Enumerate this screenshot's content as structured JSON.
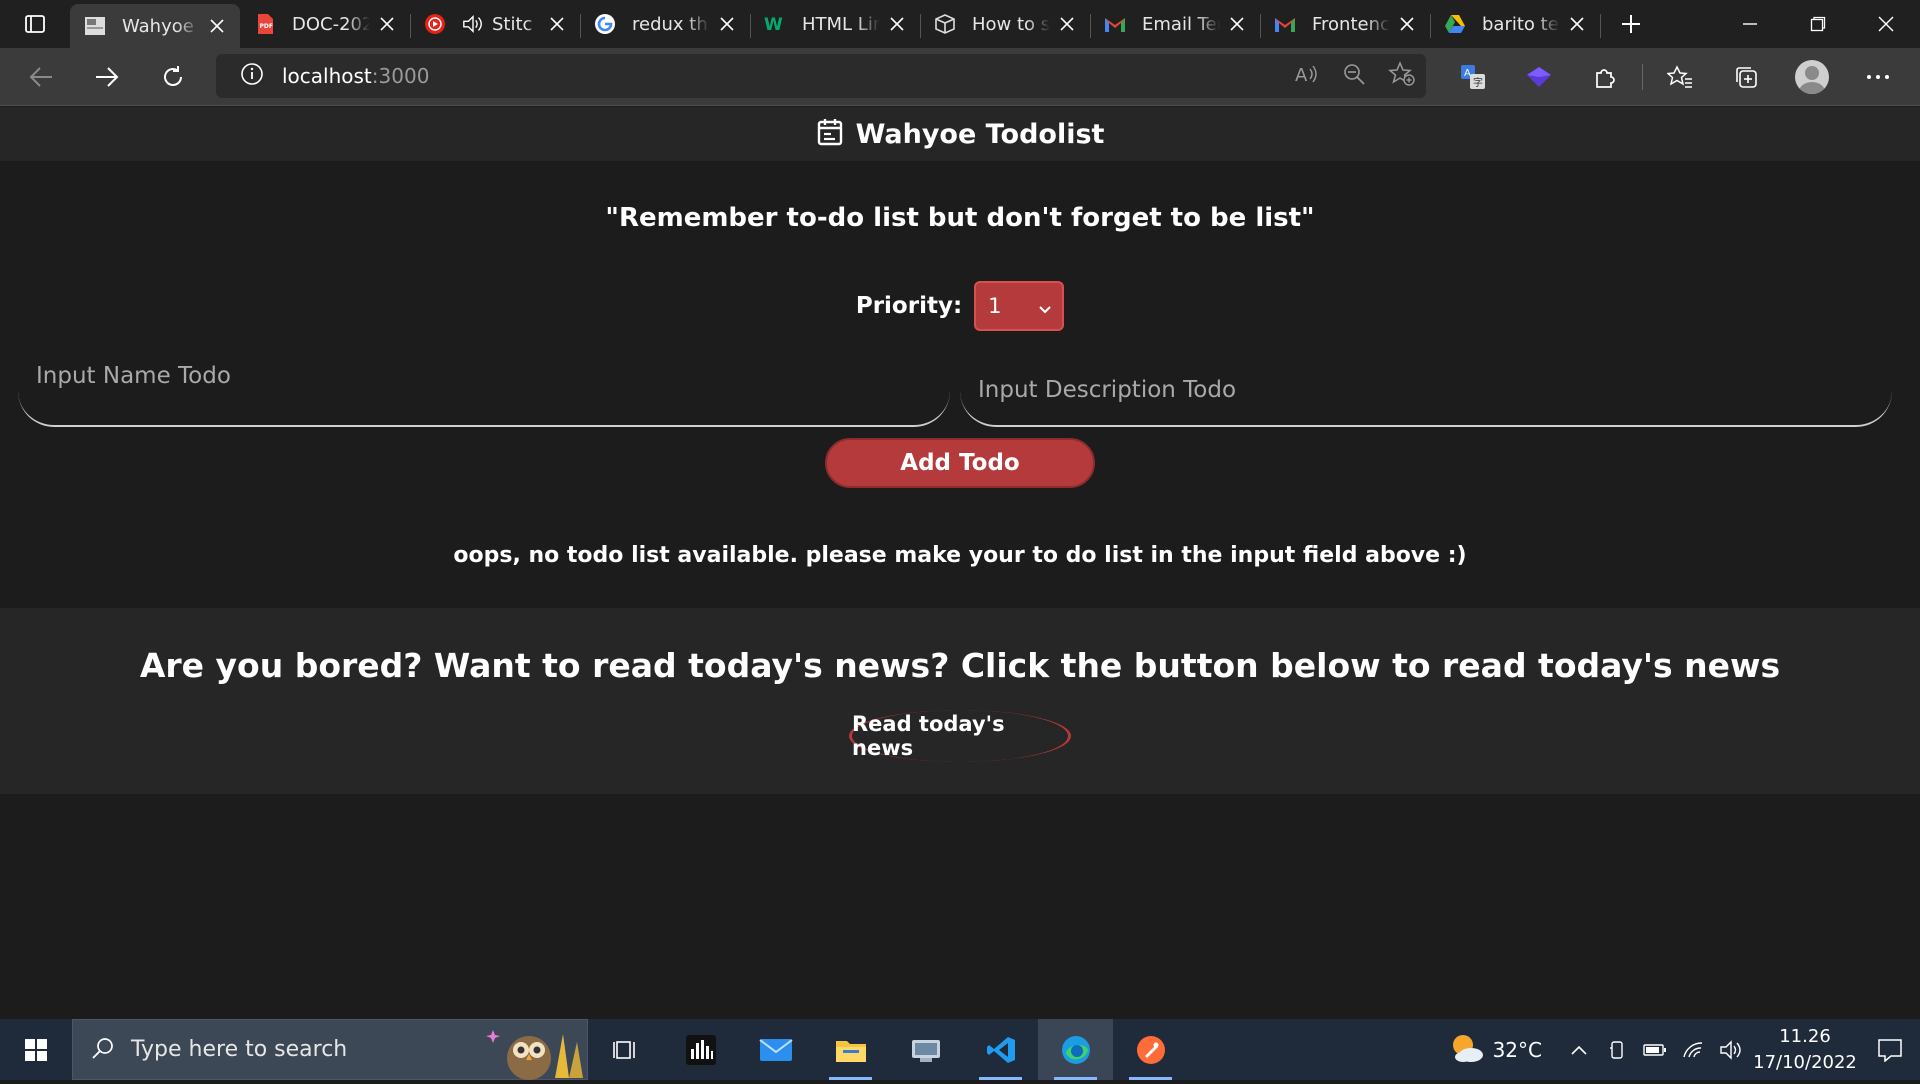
{
  "browser": {
    "tabs": [
      {
        "title": "Wahyoe",
        "icon": "page-favicon",
        "active": true
      },
      {
        "title": "DOC-202",
        "icon": "pdf-icon"
      },
      {
        "title": "Stitc",
        "icon": "youtube-icon",
        "audio": true
      },
      {
        "title": "redux th",
        "icon": "google-icon"
      },
      {
        "title": "HTML Lir",
        "icon": "w3schools-icon"
      },
      {
        "title": "How to s",
        "icon": "box-icon"
      },
      {
        "title": "Email Ter",
        "icon": "gmail-icon"
      },
      {
        "title": "Frontenc",
        "icon": "gmail-icon"
      },
      {
        "title": "barito te",
        "icon": "google-drive-icon"
      }
    ],
    "address": {
      "host": "localhost",
      "port": ":3000"
    }
  },
  "app": {
    "title": "Wahyoe Todolist",
    "quote": "\"Remember to-do list but don't forget to be list\"",
    "priority_label": "Priority:",
    "priority_value": "1",
    "name_placeholder": "Input Name Todo",
    "desc_placeholder": "Input Description Todo",
    "add_button": "Add Todo",
    "empty_message": "oops, no todo list available. please make your to do list in the input field above :)",
    "news_headline": "Are you bored? Want to read today's news? Click the button below to read today's news",
    "news_button": "Read today's news"
  },
  "taskbar": {
    "search_placeholder": "Type here to search",
    "temperature": "32°C",
    "time": "11.26",
    "date": "17/10/2022"
  },
  "colors": {
    "accent": "#b43a3c",
    "page_bg": "#1c1c1c",
    "band_bg": "#262626"
  }
}
